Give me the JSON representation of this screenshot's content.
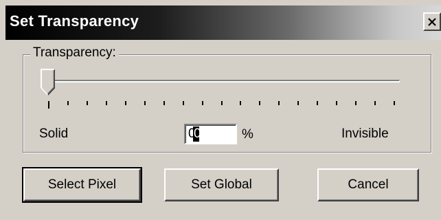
{
  "window": {
    "title": "Set Transparency",
    "close_icon": "close-icon"
  },
  "group": {
    "label": "Transparency:"
  },
  "slider": {
    "value_percent": 0,
    "tick_count": 19
  },
  "labels": {
    "left": "Solid",
    "right": "Invisible",
    "unit": "%"
  },
  "input": {
    "value": "0"
  },
  "buttons": {
    "select_pixel": "Select Pixel",
    "set_global": "Set Global",
    "cancel": "Cancel"
  },
  "colors": {
    "face": "#d4d0c8",
    "title_gradient_start": "#000000",
    "title_text": "#ffffff"
  }
}
